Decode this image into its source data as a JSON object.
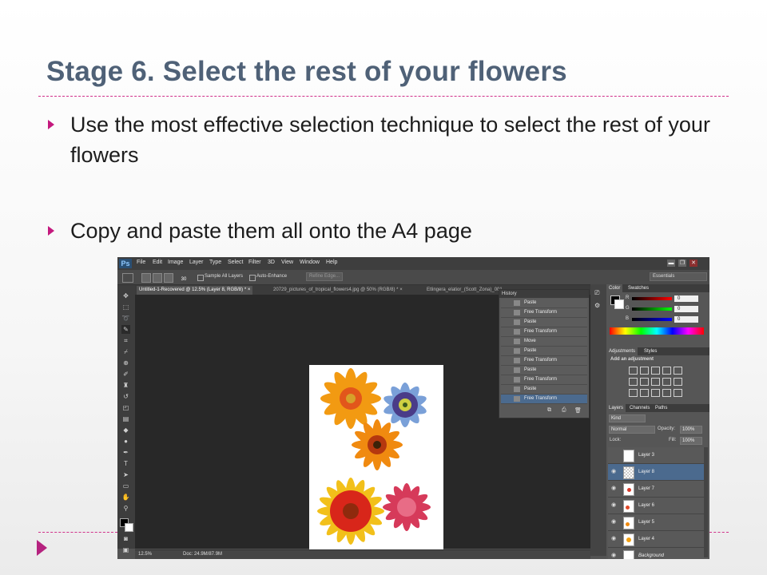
{
  "slide": {
    "title": "Stage 6. Select the rest of your flowers",
    "bullets": [
      "Use the most effective selection technique to select the rest of your flowers",
      "Copy and paste them all onto the A4 page"
    ],
    "colors": {
      "title": "#4f6177",
      "accent": "#c4197e",
      "divider": "#d1308a"
    }
  },
  "photoshop": {
    "logo": "Ps",
    "menu": [
      "File",
      "Edit",
      "Image",
      "Layer",
      "Type",
      "Select",
      "Filter",
      "3D",
      "View",
      "Window",
      "Help"
    ],
    "window_controls": {
      "minimize": "▬",
      "restore": "❐",
      "close": "✕"
    },
    "options_bar": {
      "sample_all_layers": "Sample All Layers",
      "auto_enhance": "Auto-Enhance",
      "refine_edge": "Refine Edge...",
      "brush_size": "30",
      "workspace": "Essentials"
    },
    "tabs": [
      {
        "label": "Untitled-1-Recovered @ 12.5% (Layer 8, RGB/8) *",
        "close": "×"
      },
      {
        "label": "20729_pictures_of_tropical_flowers4.jpg @ 50% (RGB/8) *",
        "close": "×"
      },
      {
        "label": "Etlingera_elatior_(Scott_Zona)_001...",
        "close": ""
      }
    ],
    "status": {
      "zoom": "12.5%",
      "doc": "Doc: 24.9M/87.9M"
    },
    "history": {
      "title": "History",
      "items": [
        "Paste",
        "Free Transform",
        "Paste",
        "Free Transform",
        "Move",
        "Paste",
        "Free Transform",
        "Paste",
        "Free Transform",
        "Paste",
        "Free Transform"
      ],
      "selected_index": 10
    },
    "color_panel": {
      "tabs": [
        "Color",
        "Swatches"
      ],
      "channels": [
        {
          "label": "R",
          "value": "0"
        },
        {
          "label": "G",
          "value": "0"
        },
        {
          "label": "B",
          "value": "0"
        }
      ]
    },
    "adjustments": {
      "tabs": [
        "Adjustments",
        "Styles"
      ],
      "heading": "Add an adjustment"
    },
    "layers": {
      "tabs": [
        "Layers",
        "Channels",
        "Paths"
      ],
      "kind": "Kind",
      "blend": "Normal",
      "opacity_label": "Opacity:",
      "opacity": "100%",
      "lock_label": "Lock:",
      "fill_label": "Fill:",
      "fill": "100%",
      "items": [
        "Layer 3",
        "Layer 8",
        "Layer 7",
        "Layer 6",
        "Layer 5",
        "Layer 4",
        "Background"
      ],
      "selected_index": 1
    }
  }
}
